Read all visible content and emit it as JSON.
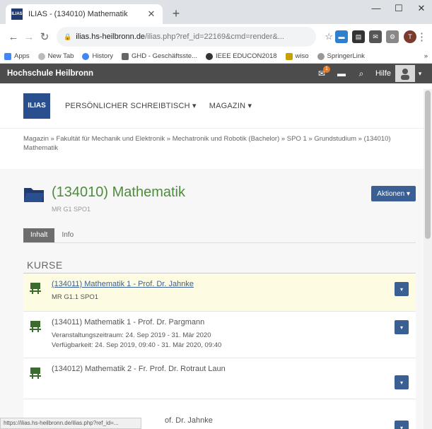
{
  "browser": {
    "tab_title": "ILIAS - (134010) Mathematik",
    "favicon_text": "ILIAS",
    "new_tab_symbol": "+",
    "url_host": "ilias.hs-heilbronn.de",
    "url_rest": "/ilias.php?ref_id=22169&cmd=render&...",
    "avatar_letter": "T",
    "bookmarks": [
      "Apps",
      "New Tab",
      "History",
      "GHD - Geschäftsste...",
      "IEEE EDUCON2018",
      "wiso",
      "SpringerLink"
    ],
    "bookmarks_more": "»",
    "status_url": "https://ilias.hs-heilbronn.de/ilias.php?ref_id=..."
  },
  "ilias_header": {
    "institution": "Hochschule Heilbronn",
    "mail_badge": "1",
    "help_label": "Hilfe"
  },
  "main_nav": {
    "logo_text": "ILIAS",
    "items": [
      "PERSÖNLICHER SCHREIBTISCH ▾",
      "MAGAZIN ▾"
    ]
  },
  "breadcrumb": "Magazin » Fakultät für Mechanik und Elektronik » Mechatronik und Robotik (Bachelor) » SPO 1 » Grundstudium » (134010) Mathematik",
  "page": {
    "title": "(134010) Mathematik",
    "subtitle": "MR G1 SPO1",
    "actions_label": "Aktionen ▾",
    "tabs": [
      {
        "label": "Inhalt",
        "active": true
      },
      {
        "label": "Info",
        "active": false
      }
    ],
    "section_heading": "KURSE"
  },
  "courses": [
    {
      "title": "(134011) Mathematik 1 - Prof. Dr. Jahnke",
      "props": [
        "MR G1.1 SPO1"
      ],
      "highlighted": true
    },
    {
      "title": "(134011) Mathematik 1 - Prof. Dr. Pargmann",
      "props": [
        "Veranstaltungszeitraum: 24. Sep 2019 - 31. Mär 2020",
        "Verfügbarkeit: 24. Sep 2019, 09:40 - 31. Mär 2020, 09:40"
      ],
      "highlighted": false
    },
    {
      "title": "(134012) Mathematik 2 - Fr. Prof. Dr. Rotraut Laun",
      "props": [],
      "highlighted": false
    },
    {
      "title": "of. Dr. Jahnke",
      "props": [],
      "highlighted": false
    }
  ],
  "colors": {
    "title_green": "#4c8c3a",
    "action_blue": "#3a5f95",
    "header_grey": "#4c4c4c",
    "highlight": "#fdfbe2"
  }
}
